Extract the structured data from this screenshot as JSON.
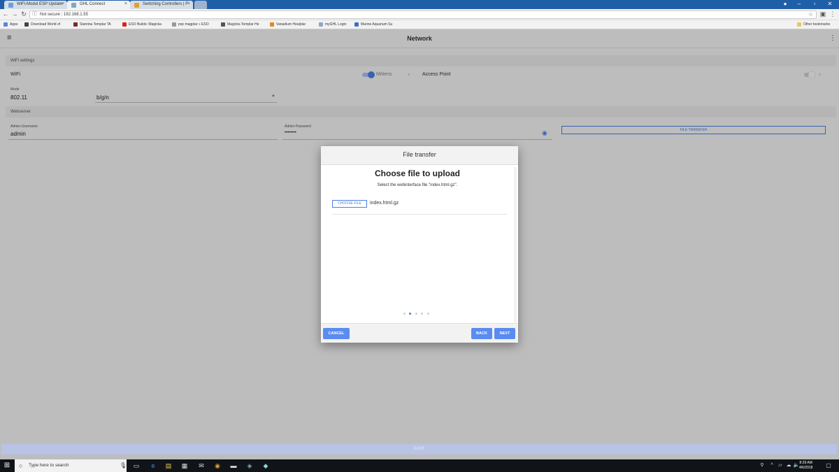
{
  "browser": {
    "tabs": [
      {
        "title": "WiFi-Modul ESP Update",
        "icon_color": "#6aa0d8"
      },
      {
        "title": "GHL Connect",
        "icon_color": "#7fa7c9"
      },
      {
        "title": "Switching Controllers | F",
        "icon_color": "#e0a030"
      }
    ],
    "security": "Not secure",
    "url": "192.168.1.55",
    "bookmarks": [
      {
        "label": "Apps",
        "icon_color": "#5b85d6"
      },
      {
        "label": "Download World of",
        "icon_color": "#444"
      },
      {
        "label": "Stamina Templar TA",
        "icon_color": "#7a2b2b"
      },
      {
        "label": "ESO Builds: Magicka",
        "icon_color": "#d22"
      },
      {
        "label": "pvp magplar » ESO",
        "icon_color": "#999"
      },
      {
        "label": "Magicka Templar He",
        "icon_color": "#555"
      },
      {
        "label": "Vanadium Healplar",
        "icon_color": "#e08a1e"
      },
      {
        "label": "myGHL Login",
        "icon_color": "#8aa7c7"
      },
      {
        "label": "Marine Aquarium Su",
        "icon_color": "#3a6fc4"
      }
    ],
    "other_bookmarks": "Other bookmarks"
  },
  "app": {
    "title": "Network",
    "wifi_section": "WiFi settings",
    "wifi_label": "WiFi",
    "wifi_mode_value": "Mittens",
    "ap_label": "Access Point",
    "mode_label": "Mode",
    "mode_value": "802.11",
    "mode_select": "b/g/n",
    "webserver_section": "Webserver",
    "admin_user_label": "Admin-Username",
    "admin_user_value": "admin",
    "admin_pw_label": "Admin-Password",
    "admin_pw_value": "••••••••",
    "file_transfer_button": "FILE TRANSFER",
    "save_button": "SAVE"
  },
  "dialog": {
    "header": "File transfer",
    "title": "Choose file to upload",
    "subtitle": "Select the webinterface file \"index.html.gz\".",
    "choose_button": "CHOOSE FILE",
    "file_name": "index.html.gz",
    "step_count": 5,
    "active_step": 2,
    "cancel": "CANCEL",
    "back": "BACK",
    "next": "NEXT"
  },
  "taskbar": {
    "search_placeholder": "Type here to search",
    "time": "8:29 AM",
    "date": "4/6/2018"
  }
}
